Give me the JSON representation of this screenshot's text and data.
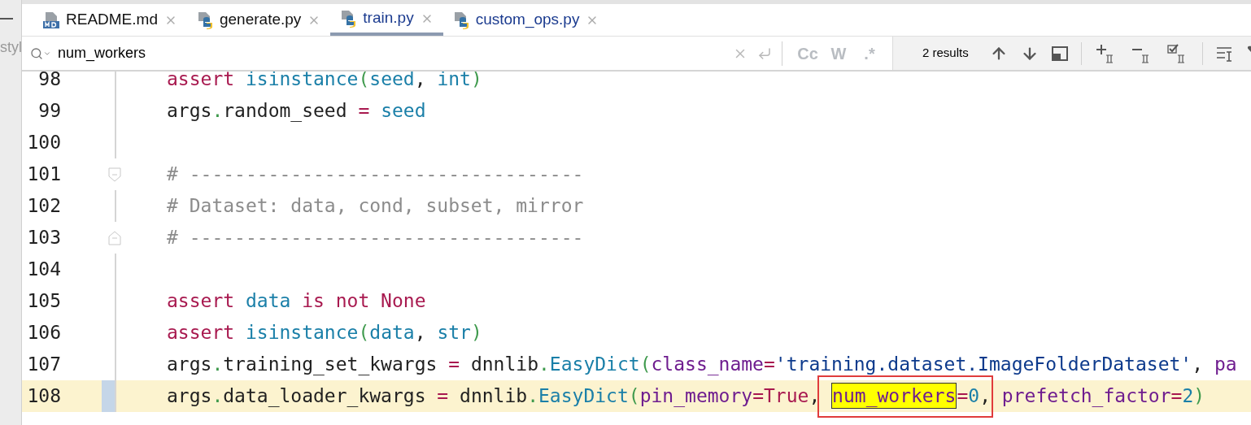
{
  "side_panel": {
    "text": "styl"
  },
  "tabs": [
    {
      "label": "README.md",
      "kind": "markdown",
      "selected": false,
      "modified": false
    },
    {
      "label": "generate.py",
      "kind": "python",
      "selected": false,
      "modified": false
    },
    {
      "label": "train.py",
      "kind": "python",
      "selected": true,
      "modified": true
    },
    {
      "label": "custom_ops.py",
      "kind": "python",
      "selected": false,
      "modified": true
    }
  ],
  "search": {
    "value": "num_workers",
    "options": [
      {
        "label": "Cc",
        "selected": false
      },
      {
        "label": "W",
        "selected": false
      },
      {
        "label": ".*",
        "selected": false
      }
    ],
    "result_count": "2 results"
  },
  "editor": {
    "lines": [
      {
        "number": "98",
        "current": false,
        "kind": "code",
        "tokens": [
          {
            "t": "assert ",
            "kind": "keyword"
          },
          {
            "t": "isinstance",
            "kind": "builtin"
          },
          {
            "t": "(",
            "kind": "paren"
          },
          {
            "t": "seed",
            "kind": "ref"
          },
          {
            "t": ", ",
            "kind": "plain"
          },
          {
            "t": "int",
            "kind": "ref"
          },
          {
            "t": ")",
            "kind": "paren"
          }
        ]
      },
      {
        "number": "99",
        "current": false,
        "kind": "code",
        "tokens": [
          {
            "t": "args",
            "kind": "plain"
          },
          {
            "t": ".",
            "kind": "dot"
          },
          {
            "t": "random_seed ",
            "kind": "plain"
          },
          {
            "t": "= ",
            "kind": "op"
          },
          {
            "t": "seed",
            "kind": "ref"
          }
        ]
      },
      {
        "number": "100",
        "current": false,
        "kind": "code"
      },
      {
        "number": "101",
        "current": false,
        "kind": "fold_start",
        "tokens": [
          {
            "t": "# -----------------------------------",
            "kind": "comment"
          }
        ]
      },
      {
        "number": "102",
        "current": false,
        "kind": "code",
        "tokens": [
          {
            "t": "# Dataset: data, cond, subset, mirror",
            "kind": "comment"
          }
        ]
      },
      {
        "number": "103",
        "current": false,
        "kind": "fold_end",
        "tokens": [
          {
            "t": "# -----------------------------------",
            "kind": "comment"
          }
        ]
      },
      {
        "number": "104",
        "current": false,
        "kind": "code"
      },
      {
        "number": "105",
        "current": false,
        "kind": "code",
        "tokens": [
          {
            "t": "assert ",
            "kind": "keyword"
          },
          {
            "t": "data ",
            "kind": "ref"
          },
          {
            "t": "is not None",
            "kind": "keyword"
          }
        ]
      },
      {
        "number": "106",
        "current": false,
        "kind": "code",
        "tokens": [
          {
            "t": "assert ",
            "kind": "keyword"
          },
          {
            "t": "isinstance",
            "kind": "builtin"
          },
          {
            "t": "(",
            "kind": "paren"
          },
          {
            "t": "data",
            "kind": "ref"
          },
          {
            "t": ", ",
            "kind": "plain"
          },
          {
            "t": "str",
            "kind": "ref"
          },
          {
            "t": ")",
            "kind": "paren"
          }
        ]
      },
      {
        "number": "107",
        "current": false,
        "kind": "code",
        "tokens": [
          {
            "t": "args",
            "kind": "plain"
          },
          {
            "t": ".",
            "kind": "dot"
          },
          {
            "t": "training_set_kwargs ",
            "kind": "plain"
          },
          {
            "t": "=",
            "kind": "op"
          },
          {
            "t": " dnnlib",
            "kind": "plain"
          },
          {
            "t": ".",
            "kind": "dot"
          },
          {
            "t": "EasyDict",
            "kind": "builtin"
          },
          {
            "t": "(",
            "kind": "paren"
          },
          {
            "t": "class_name",
            "kind": "param"
          },
          {
            "t": "=",
            "kind": "op"
          },
          {
            "t": "'training.dataset.ImageFolderDataset'",
            "kind": "string"
          },
          {
            "t": ", ",
            "kind": "plain"
          },
          {
            "t": "pa",
            "kind": "param"
          }
        ]
      },
      {
        "number": "108",
        "current": true,
        "kind": "code",
        "tokens": [
          {
            "t": "args",
            "kind": "plain"
          },
          {
            "t": ".",
            "kind": "dot"
          },
          {
            "t": "data_loader_kwargs ",
            "kind": "plain"
          },
          {
            "t": "=",
            "kind": "op"
          },
          {
            "t": " dnnlib",
            "kind": "plain"
          },
          {
            "t": ".",
            "kind": "dot"
          },
          {
            "t": "EasyDict",
            "kind": "builtin"
          },
          {
            "t": "(",
            "kind": "paren"
          },
          {
            "t": "pin_memory",
            "kind": "param"
          },
          {
            "t": "=",
            "kind": "op"
          },
          {
            "t": "True",
            "kind": "keyword"
          },
          {
            "t": ", ",
            "kind": "plain"
          },
          {
            "t": "num_workers",
            "kind": "match"
          },
          {
            "t": "=",
            "kind": "op"
          },
          {
            "t": "0",
            "kind": "number"
          },
          {
            "t": ", ",
            "kind": "plain"
          },
          {
            "t": "prefetch_factor",
            "kind": "param"
          },
          {
            "t": "=",
            "kind": "op"
          },
          {
            "t": "2",
            "kind": "number"
          },
          {
            "t": ")",
            "kind": "paren"
          }
        ]
      }
    ]
  }
}
